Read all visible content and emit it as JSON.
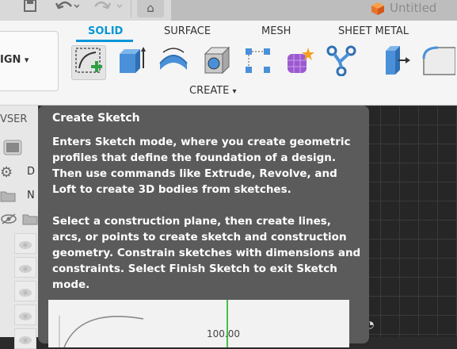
{
  "app": {
    "document_title": "Untitled",
    "workspace_label": "IGN",
    "workspace_arrow": "▾"
  },
  "ribbon": {
    "tabs": [
      {
        "label": "SOLID",
        "active": true
      },
      {
        "label": "SURFACE",
        "active": false
      },
      {
        "label": "MESH",
        "active": false
      },
      {
        "label": "SHEET METAL",
        "active": false
      }
    ],
    "group_label": "CREATE",
    "group_arrow": "▾",
    "tools": [
      {
        "name": "create-sketch-icon",
        "selected": true
      },
      {
        "name": "extrude-icon"
      },
      {
        "name": "revolve-icon"
      },
      {
        "name": "hole-icon"
      },
      {
        "name": "rectangular-pattern-icon"
      },
      {
        "name": "form-icon"
      },
      {
        "name": "joint-icon"
      },
      {
        "name": "press-pull-icon"
      },
      {
        "name": "fillet-icon"
      }
    ]
  },
  "browser": {
    "label": "VSER",
    "row_letters": [
      "D",
      "N"
    ]
  },
  "tooltip": {
    "title": "Create Sketch",
    "paragraph1": "Enters Sketch mode, where you create geometric profiles that define the foundation of a design. Then use commands like Extrude, Revolve, and Loft to create 3D bodies from sketches.",
    "paragraph2": "Select a construction plane, then create lines, arcs, or points to create sketch and construction geometry. Constrain sketches with dimensions and constraints. Select Finish Sketch to exit Sketch mode.",
    "image_dimension": "100.00"
  },
  "colors": {
    "accent": "#0696d7",
    "tooltip_bg": "#5b5b5b",
    "canvas_bg": "#262626",
    "toolbar_bg": "#f5f5f5"
  }
}
